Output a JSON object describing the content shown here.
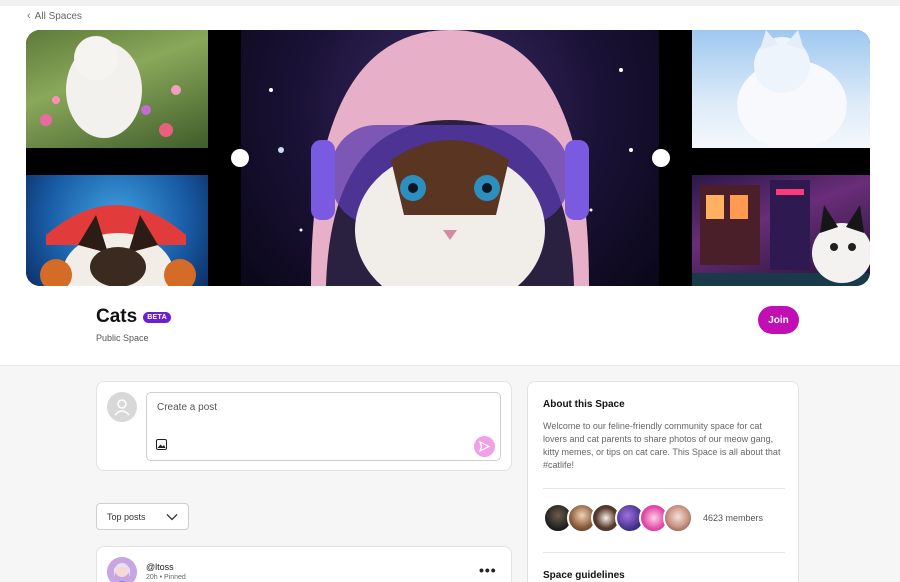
{
  "nav": {
    "back_label": "All Spaces"
  },
  "space": {
    "name": "Cats",
    "badge": "BETA",
    "visibility": "Public Space",
    "join_label": "Join",
    "accent_color": "#c20fb5"
  },
  "composer": {
    "placeholder": "Create a post"
  },
  "feed": {
    "sort_label": "Top posts"
  },
  "post": {
    "username": "@ltoss",
    "meta": "20h • Pinned"
  },
  "about": {
    "title": "About this Space",
    "description": "Welcome to our feline-friendly community space for cat lovers and cat parents to share photos of our meow gang, kitty memes, or tips on cat care. This Space is all about that #catlife!",
    "member_count": "4623 members",
    "guidelines_title": "Space guidelines"
  }
}
